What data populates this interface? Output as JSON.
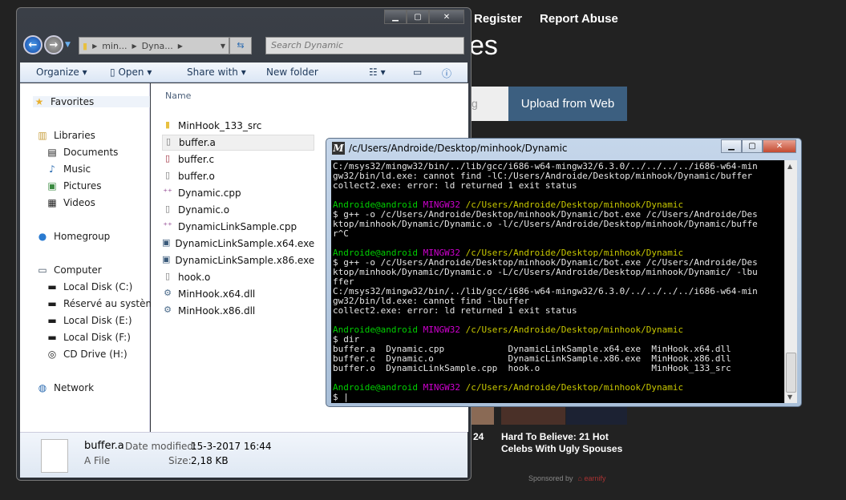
{
  "web": {
    "nav": [
      "Register",
      "Report Abuse"
    ],
    "title_fragment": "es",
    "input_fragment": "g",
    "upload_button": "Upload from Web",
    "ad_number": "24",
    "ad_caption": "Hard To Believe: 21 Hot Celebs With Ugly Spouses",
    "sponsored": "Sponsored by",
    "sponsor_logo": "earnify",
    "accent": "#3c5f80"
  },
  "explorer": {
    "address": [
      "min...",
      "Dyna..."
    ],
    "search_placeholder": "Search Dynamic",
    "toolbar": {
      "organize": "Organize",
      "open": "Open",
      "share": "Share with",
      "new_folder": "New folder"
    },
    "nav": {
      "favorites": "Favorites",
      "libraries": "Libraries",
      "documents": "Documents",
      "music": "Music",
      "pictures": "Pictures",
      "videos": "Videos",
      "homegroup": "Homegroup",
      "computer": "Computer",
      "c": "Local Disk (C:)",
      "reserved": "Réservé au système (",
      "e": "Local Disk (E:)",
      "f": "Local Disk (F:)",
      "h": "CD Drive (H:)",
      "network": "Network"
    },
    "column_name": "Name",
    "files": [
      {
        "name": "MinHook_133_src",
        "icon": "folder-icon"
      },
      {
        "name": "buffer.a",
        "icon": "file-icon",
        "selected": true
      },
      {
        "name": "buffer.c",
        "icon": "c-source-icon"
      },
      {
        "name": "buffer.o",
        "icon": "file-icon"
      },
      {
        "name": "Dynamic.cpp",
        "icon": "cpp-source-icon"
      },
      {
        "name": "Dynamic.o",
        "icon": "file-icon"
      },
      {
        "name": "DynamicLinkSample.cpp",
        "icon": "cpp-source-icon"
      },
      {
        "name": "DynamicLinkSample.x64.exe",
        "icon": "exe-icon"
      },
      {
        "name": "DynamicLinkSample.x86.exe",
        "icon": "exe-icon"
      },
      {
        "name": "hook.o",
        "icon": "file-icon"
      },
      {
        "name": "MinHook.x64.dll",
        "icon": "dll-icon"
      },
      {
        "name": "MinHook.x86.dll",
        "icon": "dll-icon"
      }
    ],
    "details": {
      "name": "buffer.a",
      "type": "A File",
      "modified_label": "Date modified:",
      "modified": "15-3-2017 16:44",
      "size_label": "Size:",
      "size": "2,18 KB"
    }
  },
  "terminal": {
    "title": "/c/Users/Androide/Desktop/minhook/Dynamic",
    "colors": {
      "user": "#00d000",
      "host": "#d000d0",
      "path": "#c8c800",
      "text": "#e6e6e6"
    },
    "lines": [
      [
        {
          "t": "C:/msys32/mingw32/bin/../lib/gcc/i686-w64-mingw32/6.3.0/../../../../i686-w64-min"
        }
      ],
      [
        {
          "t": "gw32/bin/ld.exe: cannot find -lC:/Users/Androide/Desktop/minhook/Dynamic/buffer"
        }
      ],
      [
        {
          "t": "collect2.exe: error: ld returned 1 exit status"
        }
      ],
      [],
      [
        {
          "t": "Androide@android ",
          "c": "user"
        },
        {
          "t": "MINGW32 ",
          "c": "host"
        },
        {
          "t": "/c/Users/Androide/Desktop/minhook/Dynamic",
          "c": "path"
        }
      ],
      [
        {
          "t": "$ g++ -o /c/Users/Androide/Desktop/minhook/Dynamic/bot.exe /c/Users/Androide/Des"
        }
      ],
      [
        {
          "t": "ktop/minhook/Dynamic/Dynamic.o -l/c/Users/Androide/Desktop/minhook/Dynamic/buffe"
        }
      ],
      [
        {
          "t": "r^C"
        }
      ],
      [],
      [
        {
          "t": "Androide@android ",
          "c": "user"
        },
        {
          "t": "MINGW32 ",
          "c": "host"
        },
        {
          "t": "/c/Users/Androide/Desktop/minhook/Dynamic",
          "c": "path"
        }
      ],
      [
        {
          "t": "$ g++ -o /c/Users/Androide/Desktop/minhook/Dynamic/bot.exe /c/Users/Androide/Des"
        }
      ],
      [
        {
          "t": "ktop/minhook/Dynamic/Dynamic.o -L/c/Users/Androide/Desktop/minhook/Dynamic/ -lbu"
        }
      ],
      [
        {
          "t": "ffer"
        }
      ],
      [
        {
          "t": "C:/msys32/mingw32/bin/../lib/gcc/i686-w64-mingw32/6.3.0/../../../../i686-w64-min"
        }
      ],
      [
        {
          "t": "gw32/bin/ld.exe: cannot find -lbuffer"
        }
      ],
      [
        {
          "t": "collect2.exe: error: ld returned 1 exit status"
        }
      ],
      [],
      [
        {
          "t": "Androide@android ",
          "c": "user"
        },
        {
          "t": "MINGW32 ",
          "c": "host"
        },
        {
          "t": "/c/Users/Androide/Desktop/minhook/Dynamic",
          "c": "path"
        }
      ],
      [
        {
          "t": "$ dir"
        }
      ],
      [
        {
          "t": "buffer.a  Dynamic.cpp            DynamicLinkSample.x64.exe  MinHook.x64.dll"
        }
      ],
      [
        {
          "t": "buffer.c  Dynamic.o              DynamicLinkSample.x86.exe  MinHook.x86.dll"
        }
      ],
      [
        {
          "t": "buffer.o  DynamicLinkSample.cpp  hook.o                     MinHook_133_src"
        }
      ],
      [],
      [
        {
          "t": "Androide@android ",
          "c": "user"
        },
        {
          "t": "MINGW32 ",
          "c": "host"
        },
        {
          "t": "/c/Users/Androide/Desktop/minhook/Dynamic",
          "c": "path"
        }
      ],
      [
        {
          "t": "$ |"
        }
      ]
    ]
  }
}
